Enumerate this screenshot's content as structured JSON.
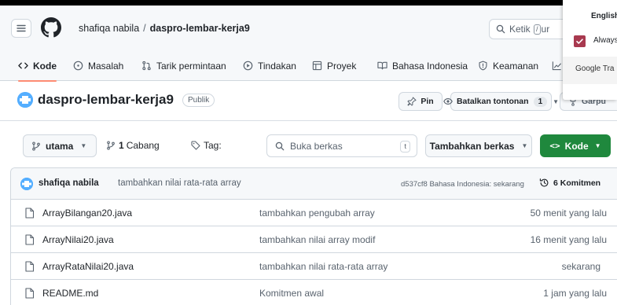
{
  "header": {
    "owner": "shafiqa nabila",
    "separator": "/",
    "repo": "daspro-lembar-kerja9",
    "search_prefix": "Ketik",
    "search_key": "/",
    "search_suffix": "ur"
  },
  "tabs": [
    {
      "label": "Kode",
      "icon": "code-icon",
      "active": true
    },
    {
      "label": "Masalah",
      "icon": "issue-icon",
      "active": false
    },
    {
      "label": "Tarik permintaan",
      "icon": "pull-request-icon",
      "active": false
    },
    {
      "label": "Tindakan",
      "icon": "play-icon",
      "active": false
    },
    {
      "label": "Proyek",
      "icon": "table-icon",
      "active": false
    },
    {
      "label": "Bahasa Indonesia",
      "icon": "book-icon",
      "active": false
    },
    {
      "label": "Keamanan",
      "icon": "shield-icon",
      "active": false
    }
  ],
  "repo_header": {
    "title": "daspro-lembar-kerja9",
    "visibility": "Publik",
    "pin_label": "Pin",
    "unwatch_label": "Batalkan tontonan",
    "watch_count": "1",
    "fork_label": "Garpu"
  },
  "toolbar": {
    "branch": "utama",
    "branch_count": "1",
    "branch_word": "Cabang",
    "tag_label": "Tag:",
    "go_to_file": "Buka berkas",
    "go_to_file_key": "t",
    "add_file": "Tambahkan berkas",
    "code_button": "Kode"
  },
  "latest_commit": {
    "author": "shafiqa nabila",
    "message": "tambahkan nilai rata-rata array",
    "hash_info": "d537cf8 Bahasa Indonesia: sekarang",
    "commit_count": "6 Komitmen"
  },
  "files": [
    {
      "name": "ArrayBilangan20.java",
      "message": "tambahkan pengubah array",
      "time": "50 menit yang lalu"
    },
    {
      "name": "ArrayNilai20.java",
      "message": "tambahkan nilai array modif",
      "time": "16 menit yang lalu"
    },
    {
      "name": "ArrayRataNilai20.java",
      "message": "tambahkan nilai rata-rata array",
      "time": "sekarang"
    },
    {
      "name": "README.md",
      "message": "Komitmen awal",
      "time": "1 jam yang lalu"
    }
  ],
  "translate_popup": {
    "language": "English",
    "always_label": "Always",
    "always_checked": true,
    "brand": "Google Tra"
  },
  "colors": {
    "code_button": "#1f883d",
    "active_tab_underline": "#fd8c73",
    "translate_check": "#a8394f"
  }
}
